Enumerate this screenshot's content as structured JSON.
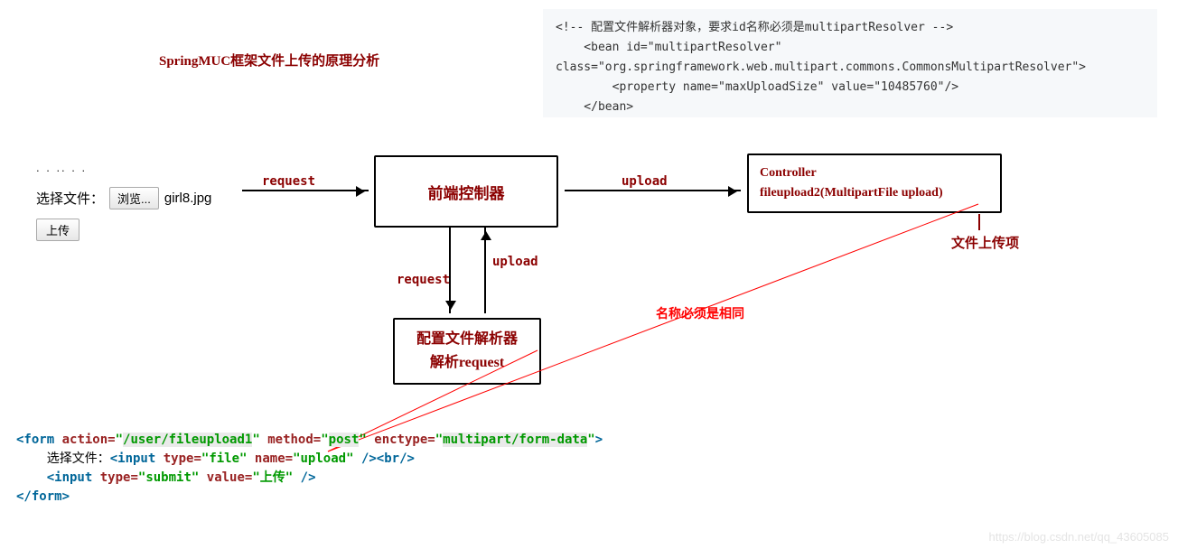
{
  "title": "SpringMUC框架文件上传的原理分析",
  "codeblock": {
    "l1": "<!-- 配置文件解析器对象，要求id名称必须是multipartResolver -->",
    "l2": "    <bean id=\"multipartResolver\"",
    "l3": "class=\"org.springframework.web.multipart.commons.CommonsMultipartResolver\">",
    "l4": "        <property name=\"maxUploadSize\" value=\"10485760\"/>",
    "l5": "    </bean>"
  },
  "form": {
    "dots": ". . .. . .",
    "label": "选择文件：",
    "browse": "浏览...",
    "filename": "girl8.jpg",
    "submit": "上传"
  },
  "boxes": {
    "front": "前端控制器",
    "parser_l1": "配置文件解析器",
    "parser_l2": "解析request",
    "ctrl_l1": "Controller",
    "ctrl_l2": "fileupload2(MultipartFile upload)"
  },
  "arrows": {
    "a1": "request",
    "a2": "upload",
    "down_left": "request",
    "down_right": "upload"
  },
  "side_label": "文件上传项",
  "red_label": "名称必须是相同",
  "bottom_code": {
    "action": "/user/fileupload1",
    "method": "post",
    "enctype": "multipart/form-data",
    "line2_label": "选择文件：",
    "input_name": "upload",
    "submit_value": "上传"
  },
  "watermark": "https://blog.csdn.net/qq_43605085"
}
